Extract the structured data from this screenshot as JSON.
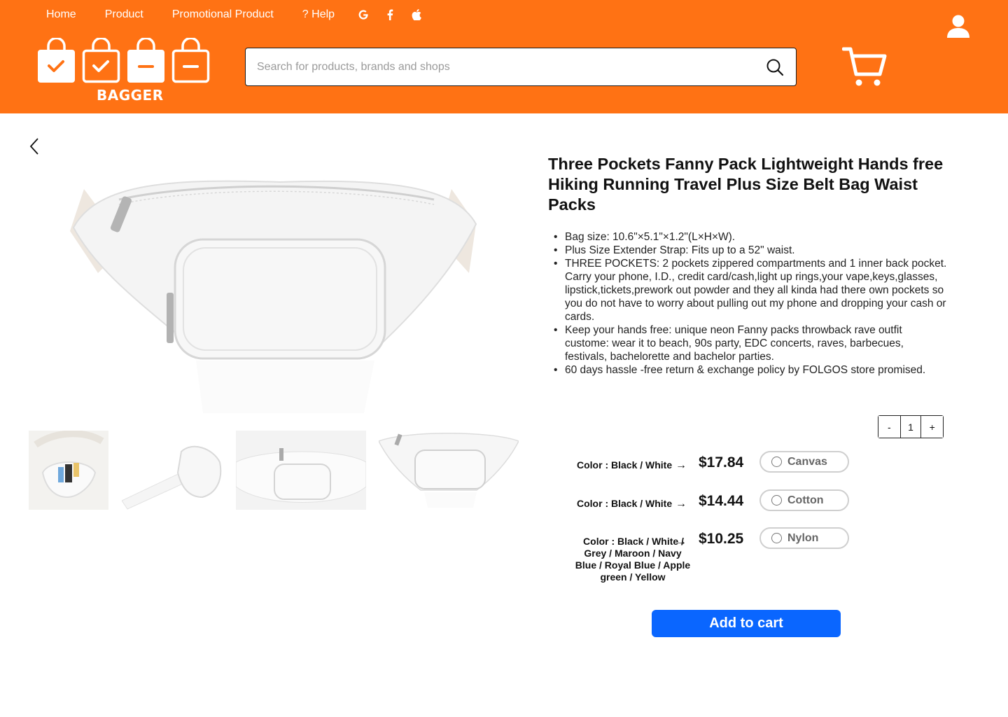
{
  "nav": {
    "home": "Home",
    "product": "Product",
    "promotional": "Promotional Product",
    "help": "? Help"
  },
  "social_icons": [
    "google-icon",
    "facebook-icon",
    "apple-icon"
  ],
  "brand": {
    "name": "BAGGER"
  },
  "search": {
    "placeholder": "Search for products, brands and shops",
    "value": ""
  },
  "colors": {
    "header_bg": "#ff7214",
    "accent_button": "#0a66ff"
  },
  "product": {
    "title": "Three Pockets Fanny Pack Lightweight Hands free Hiking Running Travel Plus Size Belt Bag Waist Packs",
    "bullets": [
      "Bag size: 10.6\"×5.1\"×1.2\"(L×H×W).",
      "Plus Size Extender Strap: Fits up to a 52\" waist.",
      "THREE POCKETS: 2 pockets zippered compartments and 1 inner back pocket. Carry your phone, I.D., credit card/cash,light up rings,your vape,keys,glasses, lipstick,tickets,prework out powder and they all kinda had there own pockets so you do not have to worry about pulling out my phone and dropping your cash or cards.",
      "Keep your hands free: unique neon Fanny packs throwback rave outfit custome: wear it to beach, 90s party, EDC concerts, raves, barbecues, festivals, bachelorette and bachelor parties.",
      "60 days hassle -free return & exchange policy by FOLGOS store promised."
    ]
  },
  "quantity": {
    "minus": "-",
    "value": "1",
    "plus": "+"
  },
  "options": [
    {
      "color_label": "Color : Black / White",
      "price": "$17.84",
      "material": "Canvas"
    },
    {
      "color_label": "Color : Black / White",
      "price": "$14.44",
      "material": "Cotton"
    },
    {
      "color_label": "Color : Black / White / Grey / Maroon / Navy Blue / Royal Blue / Apple green / Yellow",
      "price": "$10.25",
      "material": "Nylon"
    }
  ],
  "arrow_symbol": "→",
  "add_to_cart": "Add to cart"
}
